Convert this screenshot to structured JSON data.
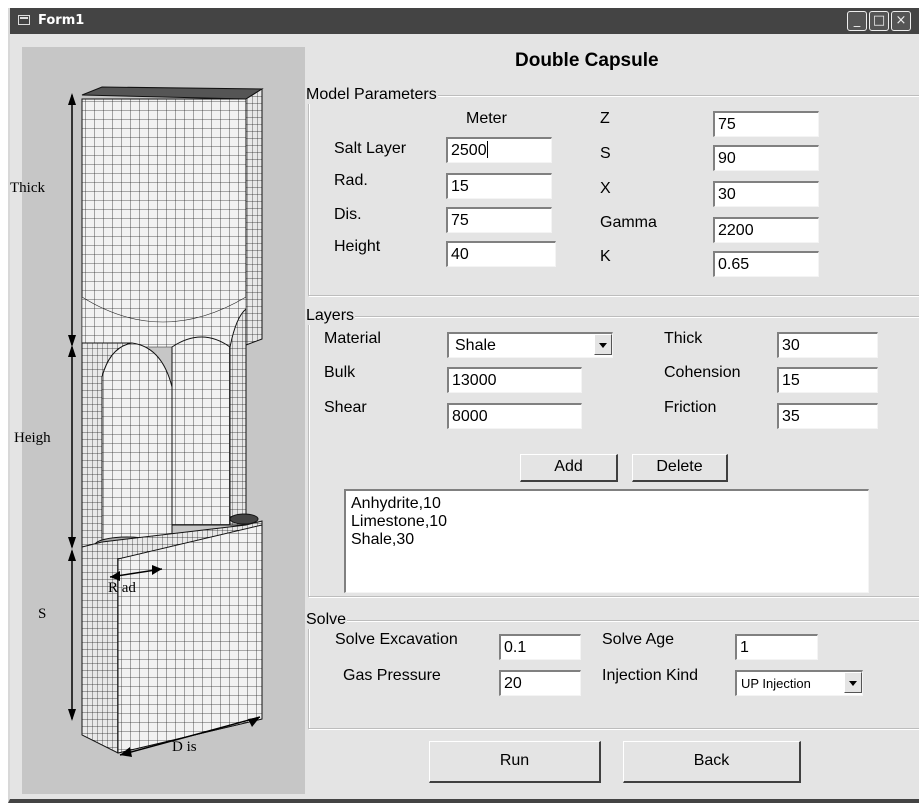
{
  "window": {
    "title": "Form1"
  },
  "form_title": "Double Capsule",
  "image_labels": {
    "thick": "Thick",
    "height": "Heigh",
    "s": "S",
    "rad": "R ad",
    "dis": "D is"
  },
  "model_parameters": {
    "legend": "Model Parameters",
    "unit_header": "Meter",
    "salt_layer": {
      "label": "Salt Layer",
      "value": "2500"
    },
    "rad": {
      "label": "Rad.",
      "value": "15"
    },
    "dis": {
      "label": "Dis.",
      "value": "75"
    },
    "height": {
      "label": "Height",
      "value": "40"
    },
    "z": {
      "label": "Z",
      "value": "75"
    },
    "s": {
      "label": "S",
      "value": "90"
    },
    "x": {
      "label": "X",
      "value": "30"
    },
    "gamma": {
      "label": "Gamma",
      "value": "2200"
    },
    "k": {
      "label": "K",
      "value": "0.65"
    }
  },
  "layers": {
    "legend": "Layers",
    "material": {
      "label": "Material",
      "value": "Shale"
    },
    "bulk": {
      "label": "Bulk",
      "value": "13000"
    },
    "shear": {
      "label": "Shear",
      "value": "8000"
    },
    "thick": {
      "label": "Thick",
      "value": "30"
    },
    "cohesion": {
      "label": "Cohension",
      "value": "15"
    },
    "friction": {
      "label": "Friction",
      "value": "35"
    },
    "add_label": "Add",
    "delete_label": "Delete",
    "list_items": [
      "Anhydrite,10",
      "Limestone,10",
      "Shale,30"
    ]
  },
  "solve": {
    "legend": "Solve",
    "excavation": {
      "label": "Solve Excavation",
      "value": "0.1"
    },
    "gas_pressure": {
      "label": "Gas Pressure",
      "value": "20"
    },
    "age": {
      "label": "Solve Age",
      "value": "1"
    },
    "injection_kind": {
      "label": "Injection Kind",
      "value": "UP Injection"
    }
  },
  "buttons": {
    "run": "Run",
    "back": "Back"
  },
  "icons": {
    "window": "form-icon",
    "minimize": "minimize-icon",
    "maximize": "maximize-icon",
    "close": "close-icon"
  },
  "colors": {
    "titlebar": "#444444",
    "client": "#e4e4e4",
    "image_panel": "#c6c6c6"
  }
}
